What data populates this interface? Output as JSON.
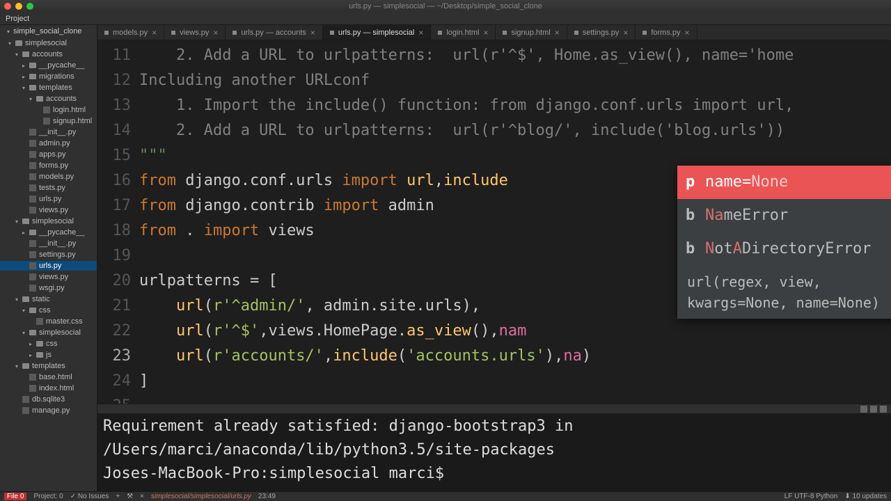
{
  "titlebar": {
    "title": "urls.py — simplesocial — ~/Desktop/simple_social_clone"
  },
  "project_header": "Project",
  "sidebar": {
    "root": "simple_social_clone",
    "tree": [
      {
        "label": "simplesocial",
        "depth": 1,
        "folder": true,
        "open": true
      },
      {
        "label": "accounts",
        "depth": 2,
        "folder": true,
        "open": true
      },
      {
        "label": "__pycache__",
        "depth": 3,
        "folder": true
      },
      {
        "label": "migrations",
        "depth": 3,
        "folder": true
      },
      {
        "label": "templates",
        "depth": 3,
        "folder": true,
        "open": true
      },
      {
        "label": "accounts",
        "depth": 4,
        "folder": true,
        "open": true
      },
      {
        "label": "login.html",
        "depth": 5
      },
      {
        "label": "signup.html",
        "depth": 5
      },
      {
        "label": "__init__.py",
        "depth": 3
      },
      {
        "label": "admin.py",
        "depth": 3
      },
      {
        "label": "apps.py",
        "depth": 3
      },
      {
        "label": "forms.py",
        "depth": 3
      },
      {
        "label": "models.py",
        "depth": 3
      },
      {
        "label": "tests.py",
        "depth": 3
      },
      {
        "label": "urls.py",
        "depth": 3
      },
      {
        "label": "views.py",
        "depth": 3
      },
      {
        "label": "simplesocial",
        "depth": 2,
        "folder": true,
        "open": true
      },
      {
        "label": "__pycache__",
        "depth": 3,
        "folder": true
      },
      {
        "label": "__init__.py",
        "depth": 3
      },
      {
        "label": "settings.py",
        "depth": 3
      },
      {
        "label": "urls.py",
        "depth": 3,
        "active": true
      },
      {
        "label": "views.py",
        "depth": 3
      },
      {
        "label": "wsgi.py",
        "depth": 3
      },
      {
        "label": "static",
        "depth": 2,
        "folder": true,
        "open": true
      },
      {
        "label": "css",
        "depth": 3,
        "folder": true,
        "open": true
      },
      {
        "label": "master.css",
        "depth": 4
      },
      {
        "label": "simplesocial",
        "depth": 3,
        "folder": true,
        "open": true
      },
      {
        "label": "css",
        "depth": 4,
        "folder": true
      },
      {
        "label": "js",
        "depth": 4,
        "folder": true
      },
      {
        "label": "templates",
        "depth": 2,
        "folder": true,
        "open": true
      },
      {
        "label": "base.html",
        "depth": 3
      },
      {
        "label": "index.html",
        "depth": 3
      },
      {
        "label": "db.sqlite3",
        "depth": 2
      },
      {
        "label": "manage.py",
        "depth": 2
      }
    ]
  },
  "tabs": [
    {
      "label": "models.py"
    },
    {
      "label": "views.py"
    },
    {
      "label": "urls.py — accounts"
    },
    {
      "label": "urls.py — simplesocial",
      "active": true
    },
    {
      "label": "login.html"
    },
    {
      "label": "signup.html"
    },
    {
      "label": "settings.py"
    },
    {
      "label": "forms.py"
    }
  ],
  "editor": {
    "first_line": 11,
    "current_line": 23,
    "lines": [
      "    2. Add a URL to urlpatterns:  url(r'^$', Home.as_view(), name='home",
      "Including another URLconf",
      "    1. Import the include() function: from django.conf.urls import url,",
      "    2. Add a URL to urlpatterns:  url(r'^blog/', include('blog.urls'))",
      "\"\"\"",
      "from django.conf.urls import url,include",
      "from django.contrib import admin",
      "from . import views",
      "",
      "urlpatterns = [",
      "    url(r'^admin/', admin.site.urls),",
      "    url(r'^$',views.HomePage.as_view(),nam",
      "    url(r'accounts/',include('accounts.urls'),na)",
      "]",
      ""
    ]
  },
  "autocomplete": {
    "items": [
      {
        "badge": "p",
        "text": "name=None",
        "selected": true
      },
      {
        "badge": "b",
        "text": "NameError"
      },
      {
        "badge": "b",
        "text": "NotADirectoryError"
      }
    ],
    "hint": "url(regex, view, kwargs=None, name=None)"
  },
  "terminal": {
    "lines": [
      "Requirement already satisfied: django-bootstrap3 in /Users/marci/anaconda/lib/python3.5/site-packages",
      "Joses-MacBook-Pro:simplesocial marci$"
    ]
  },
  "statusbar": {
    "file_badge": "File 0",
    "project": "Project: 0",
    "issues": "✓ No Issues",
    "path": "simplesocial/simplesocial/urls.py",
    "cursor": "23:49",
    "encoding": "LF  UTF-8  Python",
    "updates": "⬇ 10 updates"
  }
}
